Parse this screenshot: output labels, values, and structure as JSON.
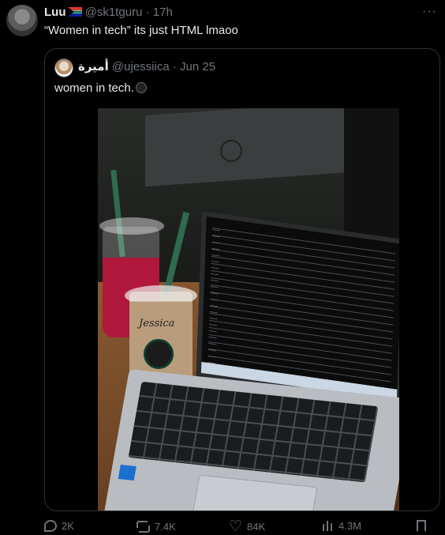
{
  "tweet": {
    "author_name": "Luu",
    "author_handle": "@sk1tguru",
    "separator": "·",
    "time": "17h",
    "more_label": "···",
    "text": "“Women in tech” its just HTML lmaoo"
  },
  "quote": {
    "author_name": "أميرة",
    "author_handle": "@ujessiica",
    "separator": "·",
    "date": "Jun 25",
    "text": "women in tech.",
    "cup_name": "Jessica"
  },
  "actions": {
    "replies": "2K",
    "reposts": "7.4K",
    "likes": "84K",
    "views": "4.3M"
  },
  "icons": {
    "flag": "south-africa-flag-icon",
    "reply": "reply-icon",
    "repost": "repost-icon",
    "like": "heart-icon",
    "views": "views-icon",
    "bookmark": "bookmark-icon"
  }
}
